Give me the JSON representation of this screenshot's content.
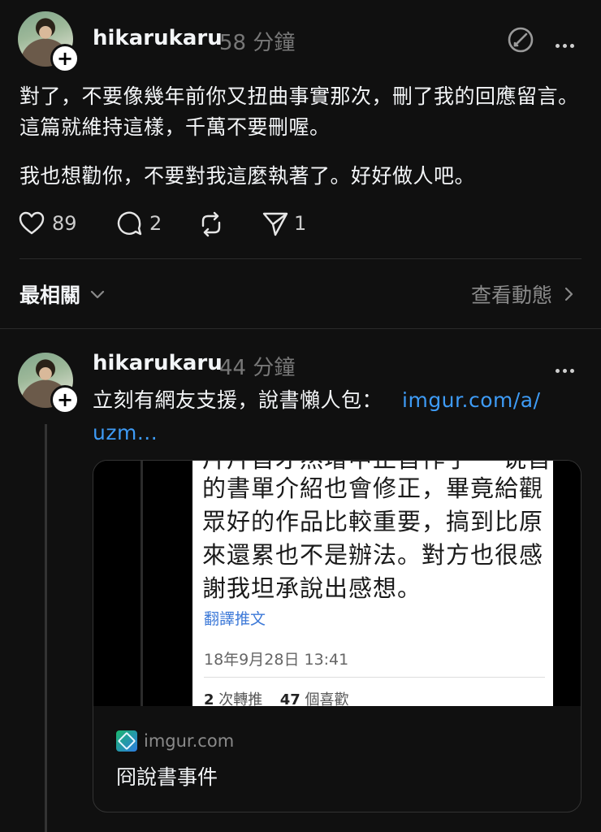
{
  "post1": {
    "username": "hikarukaru",
    "time": "58 分鐘",
    "paragraphs": [
      "對了，不要像幾年前你又扭曲事實那次，刪了我的回應留言。這篇就維持這樣，千萬不要刪喔。",
      "我也想勸你，不要對我這麼執著了。好好做人吧。"
    ],
    "likes": "89",
    "comments": "2",
    "shares": "1"
  },
  "relevance": {
    "sort_label": "最相關",
    "view_activity_label": "查看動態"
  },
  "post2": {
    "username": "hikarukaru",
    "time": "44 分鐘",
    "text": "立刻有網友支援，說書懶人包：",
    "link_line1": "imgur.com/a/",
    "link_line2": "uzm...",
    "preview": {
      "tweet_top": "片片首才然增中止首作子一 说首",
      "tweet_lines": [
        "的書單介紹也會修正，畢竟給觀",
        "眾好的作品比較重要，搞到比原",
        "來還累也不是辦法。對方也很感",
        "謝我坦承說出感想。"
      ],
      "translate_label": "翻譯推文",
      "date": "18年9月28日 13:41",
      "retweet_count": "2",
      "retweet_label": "次轉推",
      "like_count": "47",
      "like_label": "個喜歡",
      "domain": "imgur.com",
      "title": "冏說書事件"
    }
  },
  "colors": {
    "background": "#101010",
    "text": "#f3f5f7",
    "muted": "#777777",
    "link": "#3e9bf5"
  }
}
